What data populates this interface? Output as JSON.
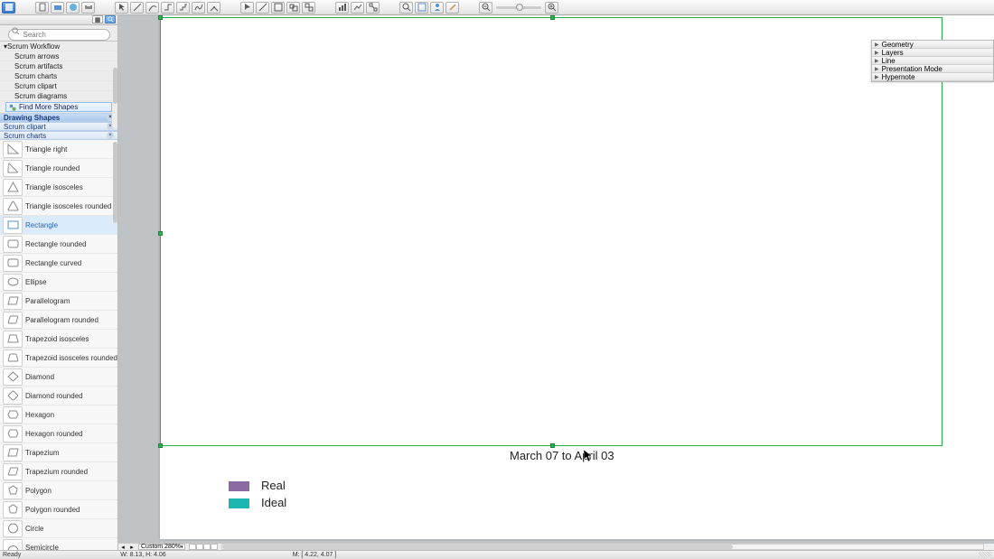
{
  "toolbar": {
    "buttons_group1": [
      "doc-icon",
      "export-icon",
      "web-icon",
      "print-icon"
    ],
    "buttons_group2": [
      "pointer-icon",
      "line-icon",
      "arc-icon",
      "connector-icon",
      "connector-step-icon",
      "connector-free-icon",
      "connector-angle-icon"
    ],
    "buttons_group3": [
      "group-icon",
      "ungroup-icon",
      "align-icon"
    ],
    "buttons_group4": [
      "zoom-in-icon",
      "fit-icon",
      "user-icon",
      "wand-icon"
    ],
    "buttons_zoom": [
      "zoom-out2-icon",
      "zoom-in2-icon"
    ]
  },
  "search": {
    "placeholder": "Search"
  },
  "tree": {
    "root": "Scrum Workflow",
    "children": [
      "Scrum arrows",
      "Scrum artifacts",
      "Scrum charts",
      "Scrum clipart",
      "Scrum diagrams"
    ]
  },
  "find_more": "Find More Shapes",
  "accordions": [
    {
      "name": "Drawing Shapes",
      "selected": true
    },
    {
      "name": "Scrum clipart",
      "selected": false
    },
    {
      "name": "Scrum charts",
      "selected": false
    }
  ],
  "shapes": [
    {
      "name": "Triangle right",
      "svg": "tri-right"
    },
    {
      "name": "Triangle rounded",
      "svg": "tri-round"
    },
    {
      "name": "Triangle isosceles",
      "svg": "tri-iso"
    },
    {
      "name": "Triangle isosceles rounded",
      "svg": "tri-iso-round"
    },
    {
      "name": "Rectangle",
      "svg": "rect",
      "selected": true
    },
    {
      "name": "Rectangle rounded",
      "svg": "rect-round"
    },
    {
      "name": "Rectangle curved",
      "svg": "rect-curve"
    },
    {
      "name": "Ellipse",
      "svg": "ellipse"
    },
    {
      "name": "Parallelogram",
      "svg": "para"
    },
    {
      "name": "Parallelogram rounded",
      "svg": "para-round"
    },
    {
      "name": "Trapezoid isosceles",
      "svg": "trap-iso"
    },
    {
      "name": "Trapezoid isosceles rounded",
      "svg": "trap-iso-round"
    },
    {
      "name": "Diamond",
      "svg": "diamond"
    },
    {
      "name": "Diamond rounded",
      "svg": "diamond-round"
    },
    {
      "name": "Hexagon",
      "svg": "hex"
    },
    {
      "name": "Hexagon rounded",
      "svg": "hex-round"
    },
    {
      "name": "Trapezium",
      "svg": "trap"
    },
    {
      "name": "Trapezium rounded",
      "svg": "trap-round"
    },
    {
      "name": "Polygon",
      "svg": "poly"
    },
    {
      "name": "Polygon rounded",
      "svg": "poly-round"
    },
    {
      "name": "Circle",
      "svg": "circle"
    },
    {
      "name": "Semicircle",
      "svg": "semi"
    }
  ],
  "inspector": [
    "Geometry",
    "Layers",
    "Line",
    "Presentation Mode",
    "Hypernote"
  ],
  "canvas": {
    "date_range": "March 07 to April 03",
    "legend": [
      {
        "label": "Real",
        "color": "#8a6aa0"
      },
      {
        "label": "Ideal",
        "color": "#1bb6b1"
      }
    ]
  },
  "statusbar": {
    "ready": "Ready",
    "wh": "W: 8.13,  H: 4.06",
    "zoom": "Custom 280%",
    "mouse": "M: [ 4.22, 4.07 ]"
  },
  "colors": {
    "selection": "#26b24a"
  }
}
